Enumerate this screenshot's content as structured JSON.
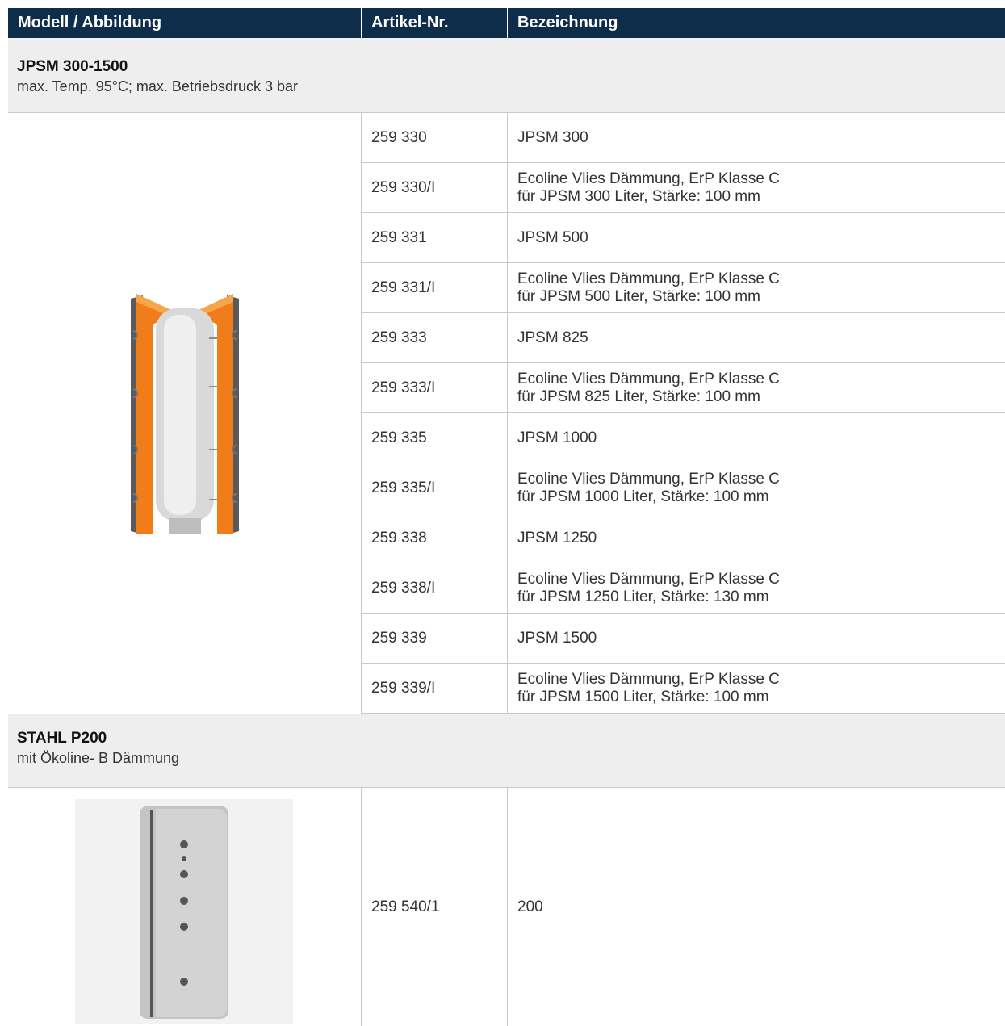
{
  "header": {
    "col_model": "Modell / Abbildung",
    "col_article": "Artikel-Nr.",
    "col_desc": "Bezeichnung"
  },
  "sections": [
    {
      "name": "JPSM 300-1500",
      "note": "max. Temp. 95°C; max. Betriebsdruck 3 bar",
      "image": "buffer-tank-cutaway-image",
      "rows": [
        {
          "article": "259 330",
          "line1": "JPSM 300",
          "line2": ""
        },
        {
          "article": "259 330/I",
          "line1": "Ecoline Vlies Dämmung, ErP Klasse C",
          "line2": "für JPSM 300 Liter, Stärke: 100 mm"
        },
        {
          "article": "259 331",
          "line1": "JPSM 500",
          "line2": ""
        },
        {
          "article": "259 331/I",
          "line1": "Ecoline Vlies Dämmung, ErP Klasse C",
          "line2": "für JPSM 500 Liter, Stärke: 100 mm"
        },
        {
          "article": "259 333",
          "line1": "JPSM 825",
          "line2": ""
        },
        {
          "article": "259 333/I",
          "line1": "Ecoline Vlies Dämmung, ErP Klasse C",
          "line2": "für JPSM 825 Liter, Stärke: 100 mm"
        },
        {
          "article": "259 335",
          "line1": "JPSM 1000",
          "line2": ""
        },
        {
          "article": "259 335/I",
          "line1": "Ecoline Vlies Dämmung, ErP Klasse C",
          "line2": "für JPSM 1000 Liter, Stärke: 100 mm"
        },
        {
          "article": "259 338",
          "line1": "JPSM 1250",
          "line2": ""
        },
        {
          "article": "259 338/I",
          "line1": "Ecoline Vlies Dämmung, ErP Klasse C",
          "line2": "für JPSM 1250 Liter, Stärke: 130 mm"
        },
        {
          "article": "259 339",
          "line1": "JPSM 1500",
          "line2": ""
        },
        {
          "article": "259 339/I",
          "line1": "Ecoline Vlies Dämmung, ErP Klasse C",
          "line2": "für JPSM 1500 Liter, Stärke: 100 mm"
        }
      ]
    },
    {
      "name": "STAHL P200",
      "note": "mit Ökoline- B Dämmung",
      "image": "steel-tank-image",
      "rows": [
        {
          "article": "259 540/1",
          "line1": "200",
          "line2": ""
        }
      ]
    }
  ],
  "colors": {
    "header_bg": "#0e2d4a",
    "section_bg": "#eeeeee",
    "insulation_orange": "#f07d1a"
  }
}
